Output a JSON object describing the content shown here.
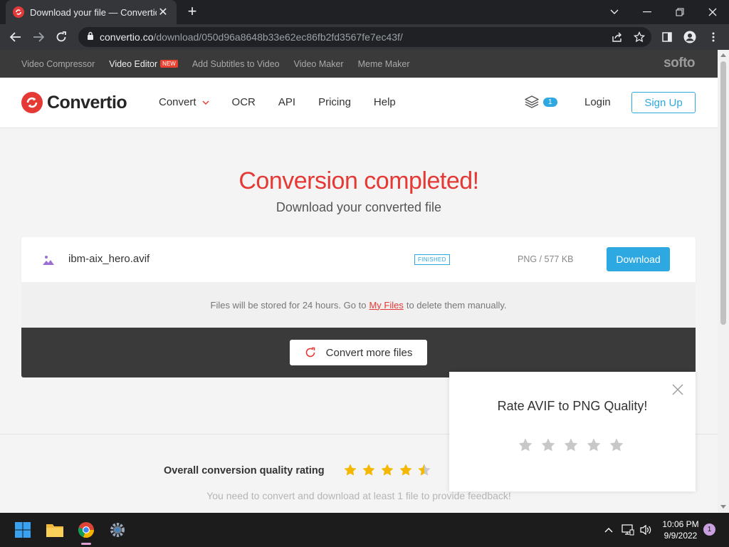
{
  "browser": {
    "tab_title": "Download your file — Convertio",
    "url_host": "convertio.co",
    "url_path": "/download/050d96a8648b33e62ec86fb2fd3567fe7ec43f/"
  },
  "topstrip": {
    "links": [
      "Video Compressor",
      "Video Editor",
      "Add Subtitles to Video",
      "Video Maker",
      "Meme Maker"
    ],
    "new_badge": "NEW",
    "brand": "softo"
  },
  "header": {
    "logo": "Convertio",
    "nav": [
      "Convert",
      "OCR",
      "API",
      "Pricing",
      "Help"
    ],
    "layers_count": "1",
    "login": "Login",
    "signup": "Sign Up"
  },
  "main": {
    "title": "Conversion completed!",
    "subtitle": "Download your converted file",
    "file": {
      "name": "ibm-aix_hero.avif",
      "status": "FINISHED",
      "meta": "PNG / 577 KB",
      "download_label": "Download"
    },
    "storage": {
      "before": "Files will be stored for 24 hours. Go to",
      "link": "My Files",
      "after": "to delete them manually."
    },
    "convert_more": "Convert more files"
  },
  "rating": {
    "overall_label": "Overall conversion quality rating",
    "overall_stars": 4.5,
    "note": "You need to convert and download at least 1 file to provide feedback!",
    "popup_title": "Rate AVIF to PNG Quality!",
    "popup_stars": 5
  },
  "colors": {
    "accent_red": "#e53935",
    "accent_blue": "#2ea8e0",
    "star_gold": "#f5b800",
    "star_gray": "#c8c8c8"
  },
  "taskbar": {
    "time": "10:06 PM",
    "date": "9/9/2022",
    "notifications": "1"
  }
}
